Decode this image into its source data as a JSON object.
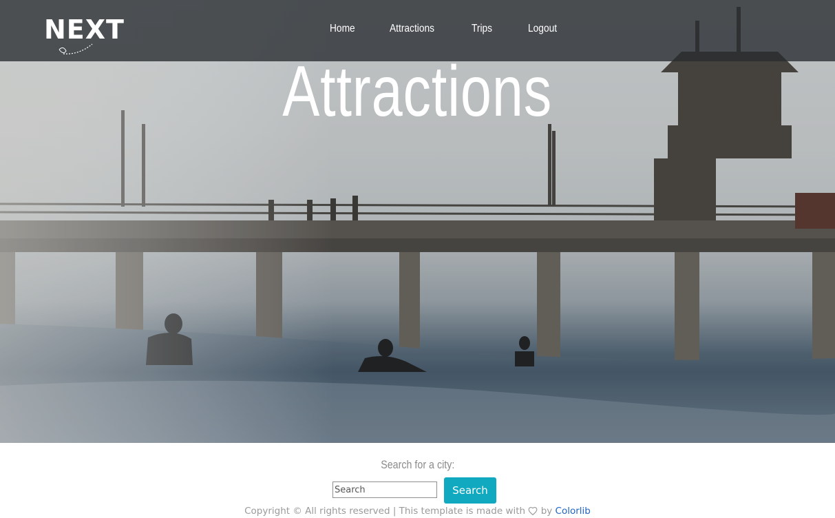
{
  "brand": {
    "logo_text": "NEXT"
  },
  "nav": {
    "items": [
      {
        "label": "Home"
      },
      {
        "label": "Attractions"
      },
      {
        "label": "Trips"
      },
      {
        "label": "Logout"
      }
    ]
  },
  "hero": {
    "title": "Attractions"
  },
  "search": {
    "label": "Search for a city:",
    "placeholder": "Search",
    "value": "",
    "button_label": "Search"
  },
  "footer": {
    "text": "Copyright © All rights reserved | This template is made with",
    "by": "by",
    "link_label": "Colorlib",
    "heart_icon": "heart-outline-icon"
  },
  "colors": {
    "accent": "#10a9c0",
    "link": "#1f63c6",
    "nav_bg": "#2c3034"
  }
}
